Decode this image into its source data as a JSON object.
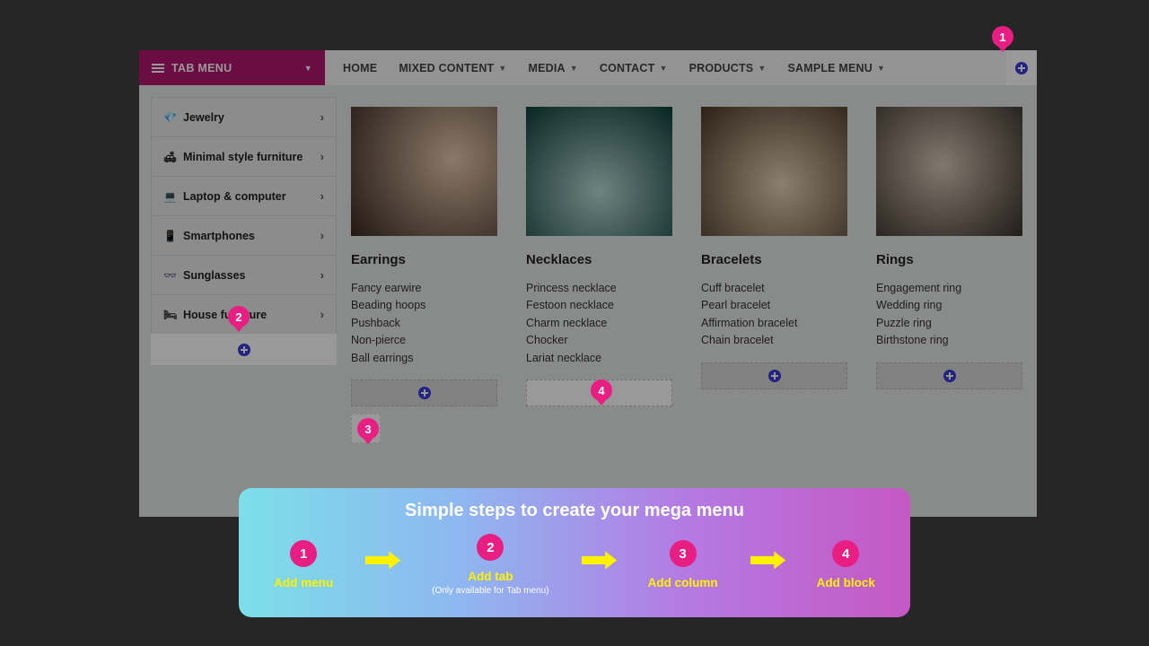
{
  "header": {
    "tab_menu_label": "TAB MENU",
    "nav": [
      "HOME",
      "MIXED CONTENT",
      "MEDIA",
      "CONTACT",
      "PRODUCTS",
      "SAMPLE MENU"
    ]
  },
  "sidebar": [
    {
      "icon": "💎",
      "label": "Jewelry"
    },
    {
      "icon": "🛋",
      "label": "Minimal style furniture"
    },
    {
      "icon": "💻",
      "label": "Laptop & computer"
    },
    {
      "icon": "📱",
      "label": "Smartphones"
    },
    {
      "icon": "👓",
      "label": "Sunglasses"
    },
    {
      "icon": "🛏",
      "label": "House furniture"
    }
  ],
  "columns": [
    {
      "title": "Earrings",
      "links": [
        "Fancy earwire",
        "Beading hoops",
        "Pushback",
        "Non-pierce",
        "Ball earrings"
      ]
    },
    {
      "title": "Necklaces",
      "links": [
        "Princess necklace",
        "Festoon necklace",
        "Charm necklace",
        "Chocker",
        "Lariat necklace"
      ]
    },
    {
      "title": "Bracelets",
      "links": [
        "Cuff bracelet",
        "Pearl bracelet",
        "Affirmation bracelet",
        "Chain bracelet"
      ]
    },
    {
      "title": "Rings",
      "links": [
        "Engagement ring",
        "Wedding ring",
        "Puzzle ring",
        "Birthstone ring"
      ]
    }
  ],
  "pins": [
    "1",
    "2",
    "3",
    "4"
  ],
  "guide": {
    "title": "Simple steps to create your mega menu",
    "steps": [
      {
        "n": "1",
        "label": "Add menu",
        "extra": ""
      },
      {
        "n": "2",
        "label": "Add tab",
        "extra": "(Only available for Tab menu)"
      },
      {
        "n": "3",
        "label": "Add column",
        "extra": ""
      },
      {
        "n": "4",
        "label": "Add block",
        "extra": ""
      }
    ]
  }
}
